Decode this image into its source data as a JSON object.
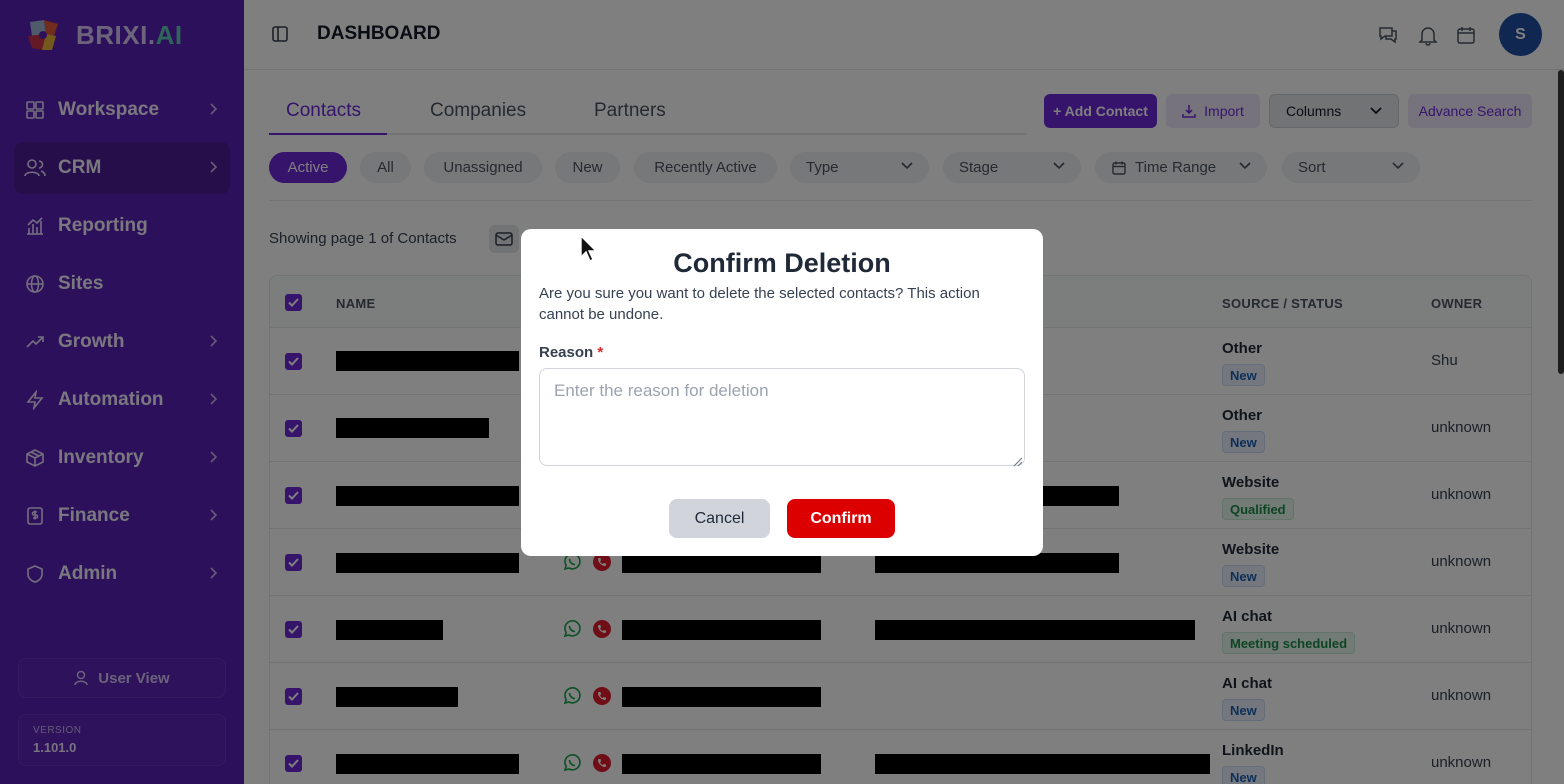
{
  "app": {
    "logo_text": "BRIXI.",
    "logo_suffix": "AI"
  },
  "sidebar": {
    "items": [
      {
        "label": "Workspace",
        "icon": "workspace-grid-icon",
        "has_chevron": true
      },
      {
        "label": "CRM",
        "icon": "users-icon",
        "has_chevron": true,
        "active": true
      },
      {
        "label": "Reporting",
        "icon": "reporting-chart-icon",
        "has_chevron": false
      },
      {
        "label": "Sites",
        "icon": "globe-icon",
        "has_chevron": false
      },
      {
        "label": "Growth",
        "icon": "trending-up-icon",
        "has_chevron": true
      },
      {
        "label": "Automation",
        "icon": "lightning-icon",
        "has_chevron": true
      },
      {
        "label": "Inventory",
        "icon": "box-icon",
        "has_chevron": true
      },
      {
        "label": "Finance",
        "icon": "dollar-doc-icon",
        "has_chevron": true
      },
      {
        "label": "Admin",
        "icon": "shield-icon",
        "has_chevron": true
      }
    ],
    "user_view_label": "User View",
    "version_label": "VERSION",
    "version_value": "1.101.0"
  },
  "header": {
    "title": "DASHBOARD",
    "avatar_initial": "S"
  },
  "main": {
    "tabs": [
      "Contacts",
      "Companies",
      "Partners"
    ],
    "buttons": {
      "add_contact": "+ Add Contact",
      "import": "Import",
      "columns": "Columns",
      "advance_search": "Advance Search"
    },
    "filters": [
      "Active",
      "All",
      "Unassigned",
      "New",
      "Recently Active"
    ],
    "dropdowns": [
      "Type",
      "Stage",
      "Time Range",
      "Sort"
    ],
    "showing_text": "Showing page 1 of Contacts",
    "table": {
      "headers": {
        "name": "NAME",
        "source_status": "SOURCE / STATUS",
        "owner": "OWNER"
      },
      "rows": [
        {
          "source": "Other",
          "status": "New",
          "owner": "Shu"
        },
        {
          "source": "Other",
          "status": "New",
          "owner": "unknown"
        },
        {
          "source": "Website",
          "status": "Qualified",
          "owner": "unknown"
        },
        {
          "source": "Website",
          "status": "New",
          "owner": "unknown"
        },
        {
          "source": "AI chat",
          "status": "Meeting scheduled",
          "owner": "unknown"
        },
        {
          "source": "AI chat",
          "status": "New",
          "owner": "unknown"
        },
        {
          "source": "LinkedIn",
          "status": "New",
          "owner": "unknown"
        }
      ]
    }
  },
  "modal": {
    "title": "Confirm Deletion",
    "message": "Are you sure you want to delete the selected contacts? This action cannot be undone.",
    "reason_label": "Reason",
    "required_mark": "*",
    "reason_placeholder": "Enter the reason for deletion",
    "cancel_label": "Cancel",
    "confirm_label": "Confirm"
  },
  "colors": {
    "sidebar_bg": "#5b21b6",
    "accent": "#6d28d9",
    "confirm_red": "#dc0000",
    "badge_blue": "#1d5fb0",
    "badge_green": "#1c8a48"
  }
}
